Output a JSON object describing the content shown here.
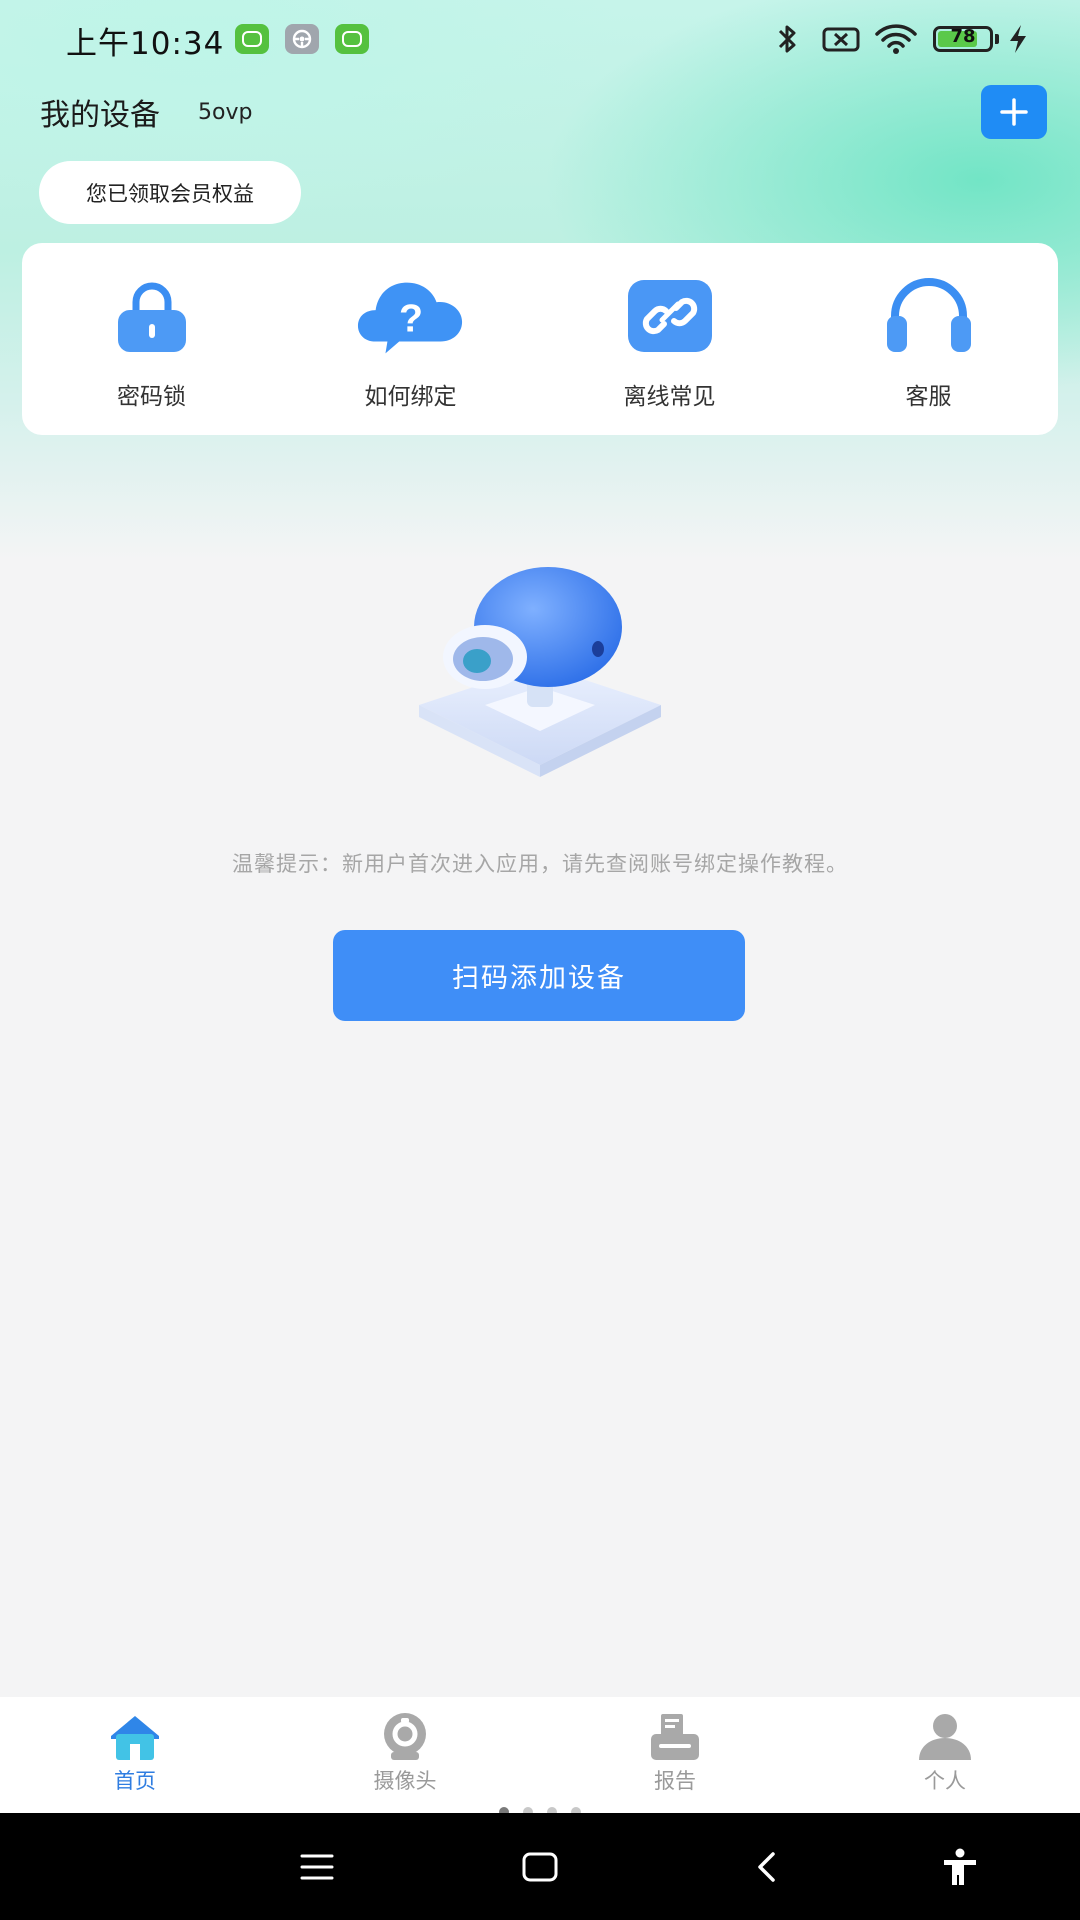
{
  "status_bar": {
    "time": "上午10:34",
    "battery_level": "78",
    "battery_fraction": 0.78,
    "icons": [
      "app-notification-icon",
      "steering-wheel-icon",
      "app-notification-icon",
      "bluetooth-icon",
      "no-sim-icon",
      "wifi-icon",
      "battery-icon",
      "charging-icon"
    ]
  },
  "header": {
    "title": "我的设备",
    "subtitle": "5ovp",
    "add_icon": "plus-icon"
  },
  "member_pill": {
    "label": "您已领取会员权益"
  },
  "quick_actions": [
    {
      "label": "密码锁",
      "icon": "lock-icon"
    },
    {
      "label": "如何绑定",
      "icon": "question-bubble-icon"
    },
    {
      "label": "离线常见",
      "icon": "link-icon"
    },
    {
      "label": "客服",
      "icon": "headset-icon"
    }
  ],
  "empty_state": {
    "illustration": "camera-illustration",
    "hint": "温馨提示：新用户首次进入应用，请先查阅账号绑定操作教程。",
    "button_label": "扫码添加设备"
  },
  "bottom_nav": [
    {
      "label": "首页",
      "icon": "home-icon",
      "active": true
    },
    {
      "label": "摄像头",
      "icon": "camera-icon",
      "active": false
    },
    {
      "label": "报告",
      "icon": "report-icon",
      "active": false
    },
    {
      "label": "个人",
      "icon": "person-icon",
      "active": false
    }
  ],
  "system_nav": [
    "menu-icon",
    "home-square-icon",
    "back-icon",
    "accessibility-icon"
  ],
  "colors": {
    "accent": "#1f8cf5",
    "button": "#3f8ef7",
    "nav_active": "#2f7de1",
    "nav_inactive": "#9a9a9a"
  }
}
